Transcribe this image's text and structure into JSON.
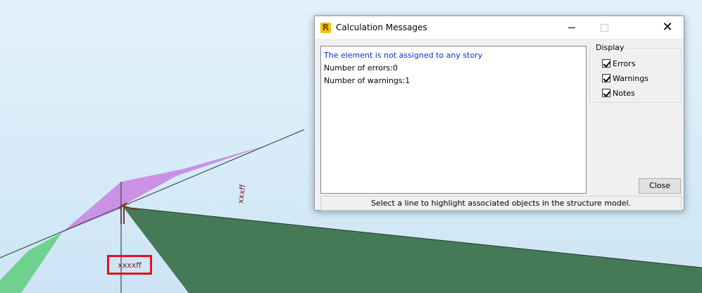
{
  "viewport": {
    "label_boxed": "xxxxff",
    "label_rotated": "xxxff"
  },
  "dialog": {
    "title": "Calculation Messages",
    "app_icon_letter": "R",
    "messages": [
      "The element is not assigned to any story",
      "Number of errors:0",
      "Number of warnings:1"
    ],
    "display": {
      "legend": "Display",
      "options": [
        {
          "label": "Errors",
          "checked": true
        },
        {
          "label": "Warnings",
          "checked": true
        },
        {
          "label": "Notes",
          "checked": true
        }
      ]
    },
    "close_label": "Close",
    "status_text": "Select a line to highlight associated objects in the structure model.",
    "close_icon": "✕"
  },
  "colors": {
    "purple_surface": "#c98ce5",
    "green_surface": "#467a57",
    "light_green_surface": "#6fd08f",
    "highlight_box": "#e3121d",
    "message_highlight": "#0b2fd1"
  }
}
